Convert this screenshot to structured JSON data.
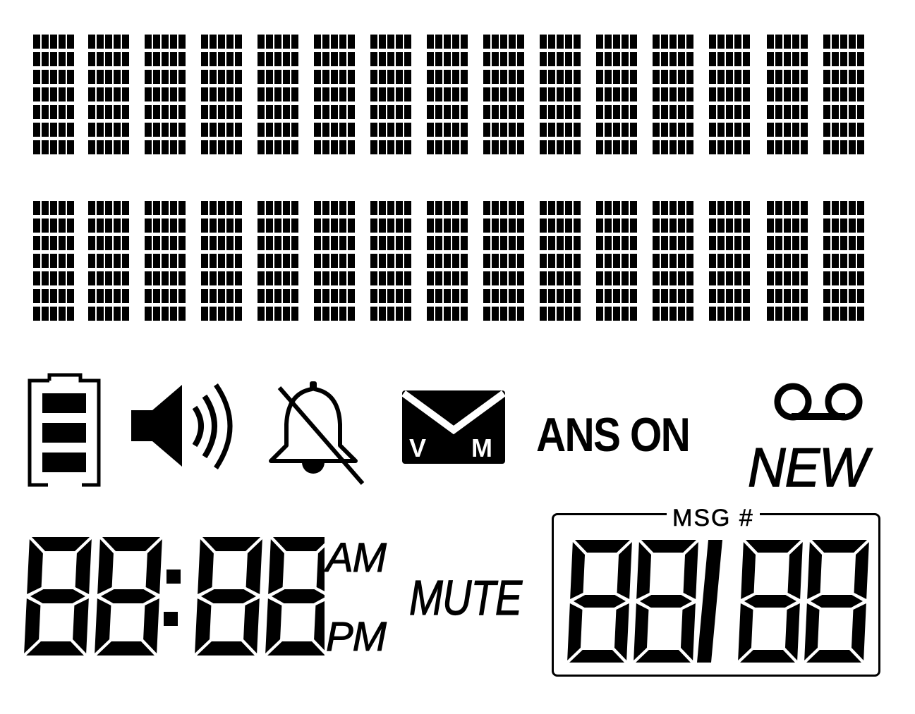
{
  "display": {
    "matrix": {
      "rows": 2,
      "characters_per_row": 15
    },
    "icons": {
      "battery": "battery-icon",
      "speaker": "speaker-volume-icon",
      "ringer_off": "bell-off-icon",
      "voicemail": "voicemail-envelope-icon",
      "tape": "answering-tape-icon"
    },
    "voicemail_letters": {
      "left": "V",
      "right": "M"
    },
    "labels": {
      "ans_on": "ANS ON",
      "new": "NEW",
      "am": "AM",
      "pm": "PM",
      "mute": "MUTE",
      "msg": "MSG #"
    },
    "clock_digits": [
      "8",
      "8",
      "8",
      "8"
    ],
    "message_digits": [
      "8",
      "8",
      "8",
      "8"
    ],
    "colors": {
      "segment": "#000000",
      "background": "#ffffff"
    }
  }
}
